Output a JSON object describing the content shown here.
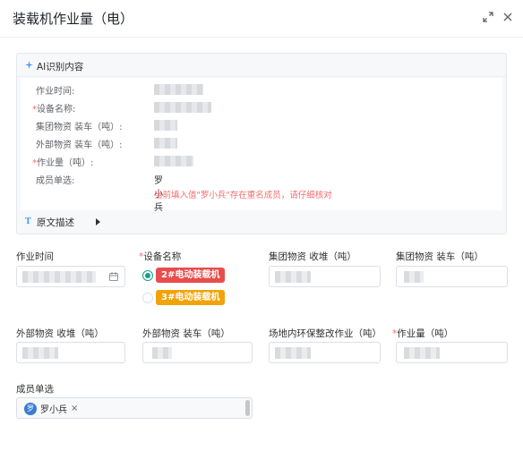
{
  "modal": {
    "title": "装载机作业量（电）",
    "expand_icon": "expand-icon",
    "close_icon": "close-icon"
  },
  "ai_panel": {
    "title": "AI识别内容",
    "icon": "sparkle-icon",
    "rows": [
      {
        "label": "作业时间:",
        "required": false
      },
      {
        "label": "设备名称:",
        "required": true
      },
      {
        "label": "集团物资 装车（吨）:",
        "required": false
      },
      {
        "label": "外部物资 装车（吨）:",
        "required": false
      },
      {
        "label": "作业量（吨）:",
        "required": true
      },
      {
        "label": "成员单选:",
        "required": false,
        "value": "罗小兵"
      }
    ],
    "warning": "当前填入值\"罗小兵\"存在重名成员，请仔细核对",
    "original_desc": {
      "label": "原文描述",
      "icon": "text-t-icon"
    }
  },
  "form": {
    "work_time": {
      "label": "作业时间",
      "icon": "calendar-icon"
    },
    "device_name": {
      "label": "设备名称",
      "required": true,
      "options": [
        {
          "label": "2#电动装载机",
          "checked": true,
          "color": "#e84d4d"
        },
        {
          "label": "3#电动装载机",
          "checked": false,
          "color": "#f0a30a"
        }
      ]
    },
    "group_unload": {
      "label": "集团物资 收堆（吨）"
    },
    "group_load": {
      "label": "集团物资 装车（吨）"
    },
    "ext_unload": {
      "label": "外部物资 收堆（吨）"
    },
    "ext_load": {
      "label": "外部物资 装车（吨）"
    },
    "env_work": {
      "label": "场地内环保整改作业（吨）"
    },
    "work_amount": {
      "label": "作业量（吨）",
      "required": true
    },
    "member": {
      "label": "成员单选",
      "selected": {
        "avatar_char": "罗",
        "name": "罗小兵",
        "remove": "×"
      }
    }
  },
  "colors": {
    "accent": "#16a085",
    "required": "#f56c6c",
    "warning": "#f56c6c",
    "avatar": "#3a7bd5"
  }
}
